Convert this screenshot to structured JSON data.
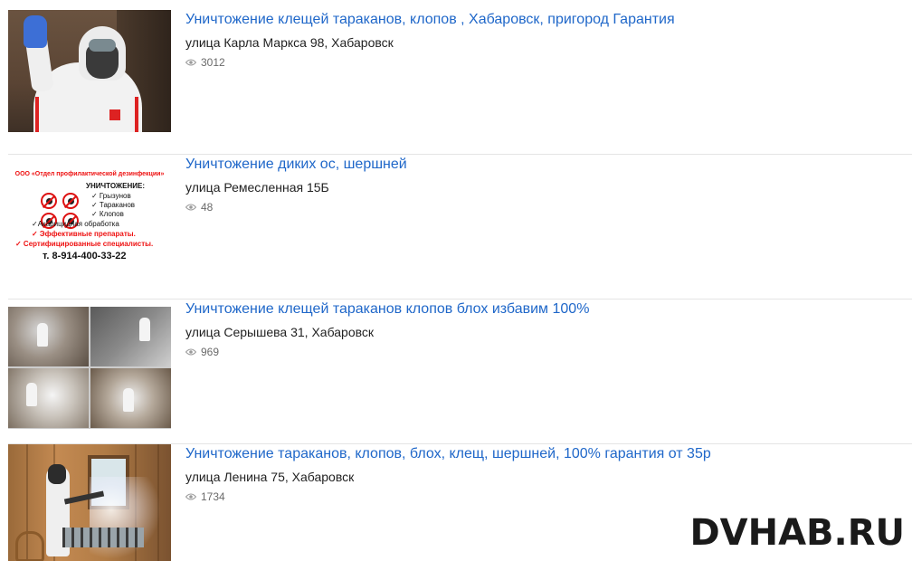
{
  "listings": [
    {
      "title": "Уничтожение клещей тараканов, клопов , Хабаровск, пригород Гарантия",
      "address": "улица Карла Маркса 98, Хабаровск",
      "views": "3012"
    },
    {
      "title": "Уничтожение диких ос, шершней",
      "address": "улица Ремесленная 15Б",
      "views": "48",
      "thumb_text": {
        "heading": "ООО «Отдел профилактической дезинфекции»",
        "line1": "УНИЧТОЖЕНИЕ:",
        "line2": "✓ Грызунов",
        "line3": "✓ Тараканов",
        "line4": "✓ Клопов",
        "line5": "✓Акарицидная обработка",
        "line6": "✓ Эффективные препараты.",
        "line7": "✓ Сертифицированные специалисты.",
        "phone": "т. 8-914-400-33-22"
      }
    },
    {
      "title": "Уничтожение клещей тараканов клопов блох избавим 100%",
      "address": "улица Серышева 31, Хабаровск",
      "views": "969"
    },
    {
      "title": "Уничтожение тараканов, клопов, блох, клещ, шершней, 100% гарантия от 35р",
      "address": "улица Ленина 75, Хабаровск",
      "views": "1734"
    }
  ],
  "watermark": "DVHAB.RU",
  "colors": {
    "link": "#1f67c9",
    "text": "#222222",
    "meta": "#6a6a6a",
    "divider": "#e4e4e4",
    "ad_red": "#e11111"
  }
}
